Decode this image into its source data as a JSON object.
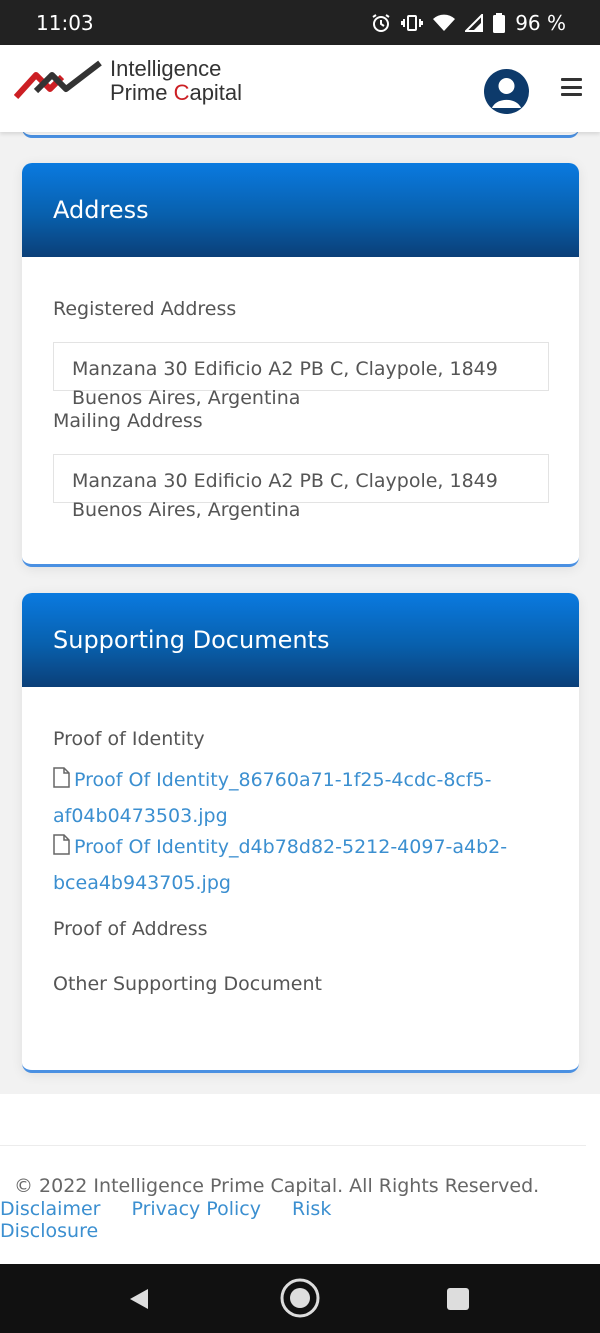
{
  "status_bar": {
    "time": "11:03",
    "battery": "96 %",
    "icons": [
      "alarm-icon",
      "vibrate-icon",
      "wifi-icon",
      "signal-icon",
      "battery-icon"
    ]
  },
  "header": {
    "logo_line1": "Intelligence",
    "logo_line2_prefix": "Prime ",
    "logo_line2_red": "C",
    "logo_line2_suffix": "apital",
    "icons": [
      "logo-icon",
      "user-avatar-icon",
      "menu-icon"
    ]
  },
  "address_card": {
    "title": "Address",
    "registered_label": "Registered Address",
    "registered_value": "Manzana 30 Edificio A2 PB C, Claypole, 1849 Buenos Aires, Argentina",
    "mailing_label": "Mailing Address",
    "mailing_value": "Manzana 30 Edificio A2 PB C, Claypole, 1849 Buenos Aires, Argentina"
  },
  "documents_card": {
    "title": "Supporting Documents",
    "identity_label": "Proof of Identity",
    "identity_files": [
      "Proof Of Identity_86760a71-1f25-4cdc-8cf5-af04b0473503.jpg",
      "Proof Of Identity_d4b78d82-5212-4097-a4b2-bcea4b943705.jpg"
    ],
    "address_label": "Proof of Address",
    "other_label": "Other Supporting Document"
  },
  "footer": {
    "copyright": "© 2022 Intelligence Prime Capital. All Rights Reserved.",
    "links": [
      "Disclaimer",
      "Privacy Policy",
      "Risk Disclosure"
    ]
  },
  "colors": {
    "accent": "#0a7ae0",
    "header_dark": "#0b3f78",
    "link": "#3b8fd0",
    "logo_red": "#cc1f24"
  }
}
